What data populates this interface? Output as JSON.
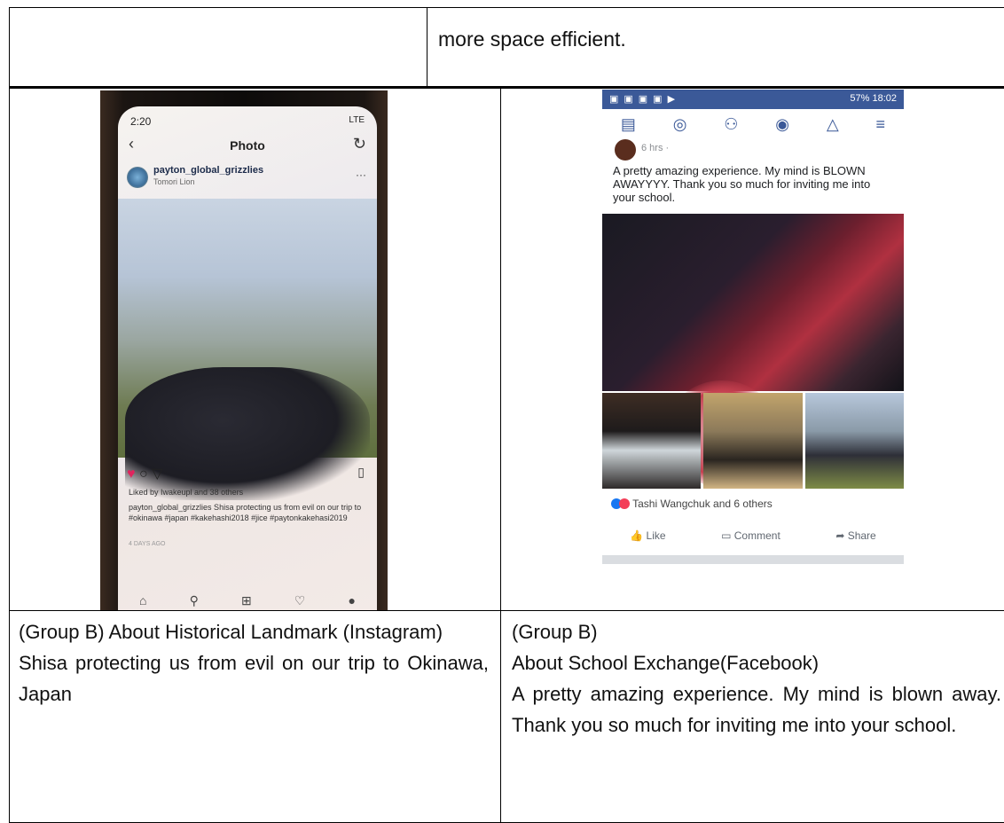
{
  "top_row": {
    "text": "more space efficient."
  },
  "instagram": {
    "time": "2:20",
    "signal": "LTE",
    "header_title": "Photo",
    "account": "payton_global_grizzlies",
    "account_sub": "Tomori Lion",
    "liked_by": "Liked by Iwakeupl and 38 others",
    "caption": "payton_global_grizzlies Shisa protecting us from evil on our trip to #okinawa #japan #kakehashi2018 #jice #paytonkakehasi2019",
    "time_ago": "4 DAYS AGO"
  },
  "facebook": {
    "status_right": "57% 18:02",
    "meta": "6 hrs · ",
    "post_text": "A pretty amazing experience. My mind is BLOWN AWAYYYY. Thank you so much for inviting me into your school.",
    "reactions": "Tashi Wangchuk and 6 others",
    "like": "Like",
    "comment": "Comment",
    "share": "Share"
  },
  "left_caption": {
    "line1": "(Group B) About Historical Landmark (Instagram)",
    "line2": "Shisa protecting us from evil on our trip to Okinawa, Japan"
  },
  "right_caption": {
    "line1": "(Group B)",
    "line2": "About School Exchange(Facebook)",
    "line3": "A pretty amazing experience. My mind is blown away. Thank you so much for inviting me into your school."
  }
}
